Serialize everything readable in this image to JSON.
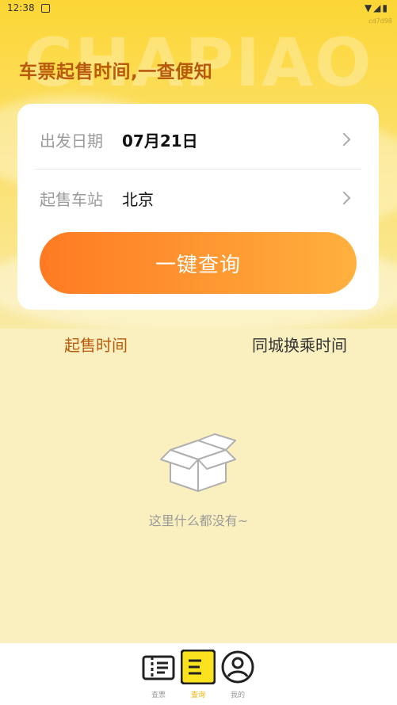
{
  "status_bar": {
    "time": "12:38",
    "code": "cd7d98",
    "right_icons": "▼◢▮"
  },
  "hero": {
    "watermark": "CHAPIAO",
    "headline": "车票起售时间,一查便知"
  },
  "form": {
    "date_label": "出发日期",
    "date_value": "07月21日",
    "station_label": "起售车站",
    "station_value": "北京",
    "query_button": "一键查询"
  },
  "tabs": [
    {
      "label": "起售时间",
      "active": true
    },
    {
      "label": "同城换乘时间",
      "active": false
    }
  ],
  "empty_state": {
    "text": "这里什么都没有~",
    "icon": "empty-box-icon"
  },
  "bottom_nav": [
    {
      "label": "查票",
      "icon": "ticket-icon",
      "active": false
    },
    {
      "label": "查询",
      "icon": "query-icon",
      "active": true
    },
    {
      "label": "我的",
      "icon": "user-icon",
      "active": false
    }
  ],
  "colors": {
    "accent": "#b85a0e",
    "button_start": "#fe7a22",
    "button_end": "#ffb13f",
    "hero_yellow": "#fcd634",
    "active_nav": "#fbe21e"
  }
}
